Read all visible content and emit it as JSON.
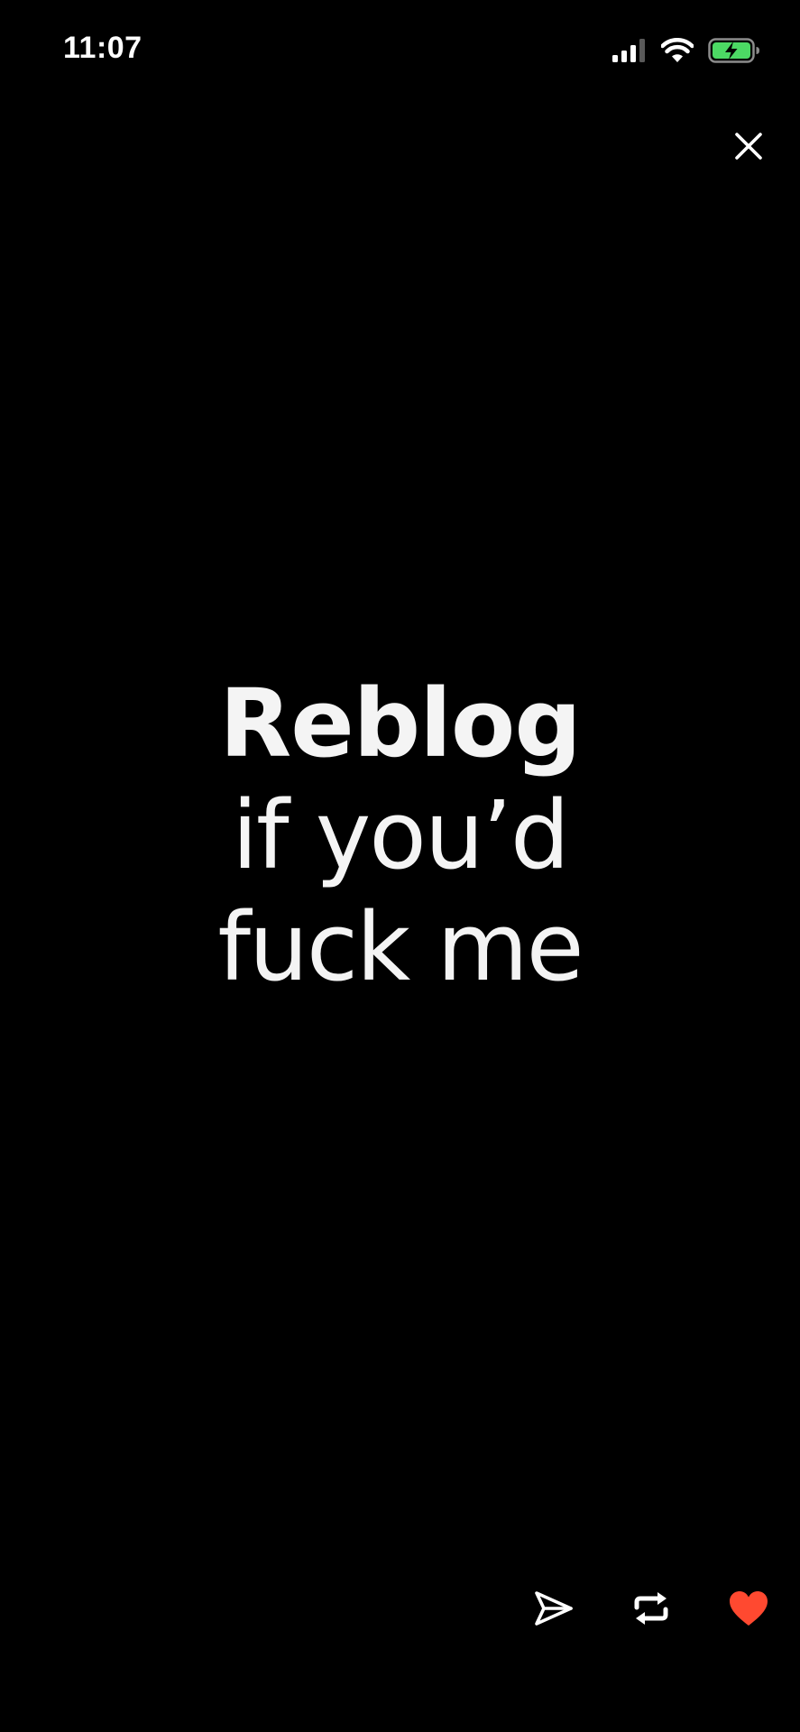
{
  "status_bar": {
    "time": "11:07",
    "icons": [
      "cellular-signal-icon",
      "wifi-icon",
      "battery-charging-icon"
    ],
    "battery_color": "#4cd964"
  },
  "viewer": {
    "close_icon": "close-icon"
  },
  "post": {
    "lines": [
      "Reblog",
      "if you’d",
      "fuck me"
    ]
  },
  "actions": {
    "share_icon": "send-icon",
    "reblog_icon": "reblog-icon",
    "like_icon": "heart-icon",
    "like_color": "#ff4930",
    "liked": true
  }
}
